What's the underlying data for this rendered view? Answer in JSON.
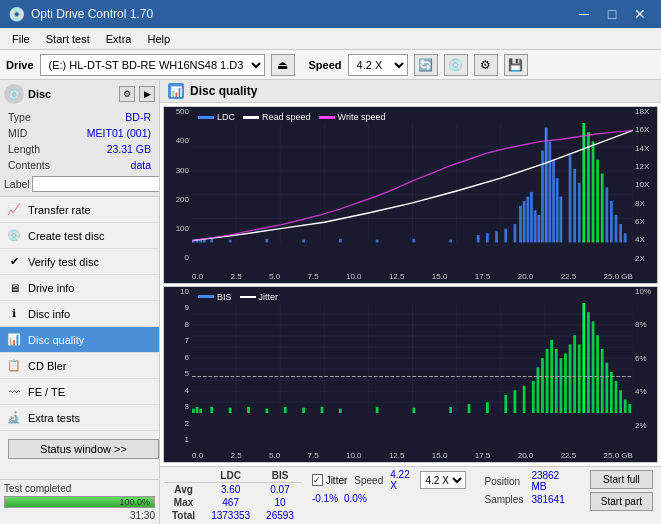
{
  "titlebar": {
    "title": "Opti Drive Control 1.70",
    "min_label": "─",
    "max_label": "□",
    "close_label": "✕"
  },
  "menubar": {
    "items": [
      "File",
      "Start test",
      "Extra",
      "Help"
    ]
  },
  "drivebar": {
    "drive_label": "Drive",
    "drive_value": "(E:)  HL-DT-ST BD-RE  WH16NS48 1.D3",
    "speed_label": "Speed",
    "speed_value": "4.2 X"
  },
  "disc": {
    "header": "Disc",
    "type_label": "Type",
    "type_value": "BD-R",
    "mid_label": "MID",
    "mid_value": "MEIT01 (001)",
    "length_label": "Length",
    "length_value": "23.31 GB",
    "contents_label": "Contents",
    "contents_value": "data",
    "label_label": "Label"
  },
  "nav": {
    "items": [
      {
        "id": "transfer-rate",
        "label": "Transfer rate"
      },
      {
        "id": "create-test-disc",
        "label": "Create test disc"
      },
      {
        "id": "verify-test-disc",
        "label": "Verify test disc"
      },
      {
        "id": "drive-info",
        "label": "Drive info"
      },
      {
        "id": "disc-info",
        "label": "Disc info"
      },
      {
        "id": "disc-quality",
        "label": "Disc quality",
        "active": true
      },
      {
        "id": "cd-bler",
        "label": "CD Bler"
      },
      {
        "id": "fe-te",
        "label": "FE / TE"
      },
      {
        "id": "extra-tests",
        "label": "Extra tests"
      }
    ],
    "status_window": "Status window >>"
  },
  "disc_quality": {
    "title": "Disc quality",
    "legend": {
      "ldc": "LDC",
      "read_speed": "Read speed",
      "write_speed": "Write speed"
    },
    "chart1": {
      "y_max": 500,
      "y_labels_left": [
        "500",
        "400",
        "300",
        "200",
        "100",
        "0"
      ],
      "y_labels_right": [
        "18X",
        "16X",
        "14X",
        "12X",
        "10X",
        "8X",
        "6X",
        "4X",
        "2X"
      ],
      "x_labels": [
        "0.0",
        "2.5",
        "5.0",
        "7.5",
        "10.0",
        "12.5",
        "15.0",
        "17.5",
        "20.0",
        "22.5",
        "25.0 GB"
      ]
    },
    "chart2": {
      "legend": {
        "bis": "BIS",
        "jitter": "Jitter"
      },
      "y_labels_left": [
        "10",
        "9",
        "8",
        "7",
        "6",
        "5",
        "4",
        "3",
        "2",
        "1"
      ],
      "y_labels_right": [
        "10%",
        "8%",
        "6%",
        "4%",
        "2%"
      ],
      "x_labels": [
        "0.0",
        "2.5",
        "5.0",
        "7.5",
        "10.0",
        "12.5",
        "15.0",
        "17.5",
        "20.0",
        "22.5",
        "25.0 GB"
      ]
    }
  },
  "stats": {
    "headers": [
      "",
      "LDC",
      "BIS",
      "",
      "Jitter",
      "Speed"
    ],
    "avg_label": "Avg",
    "avg_ldc": "3.60",
    "avg_bis": "0.07",
    "avg_jitter": "-0.1%",
    "avg_speed": "4.22 X",
    "max_label": "Max",
    "max_ldc": "467",
    "max_bis": "10",
    "max_jitter": "0.0%",
    "total_label": "Total",
    "total_ldc": "1373353",
    "total_bis": "26593",
    "position_label": "Position",
    "position_value": "23862 MB",
    "samples_label": "Samples",
    "samples_value": "381641",
    "jitter_checked": true,
    "speed_value": "4.2 X",
    "start_full_label": "Start full",
    "start_part_label": "Start part"
  },
  "statusbar": {
    "text": "Test completed",
    "progress": 100,
    "time": "31:30"
  }
}
